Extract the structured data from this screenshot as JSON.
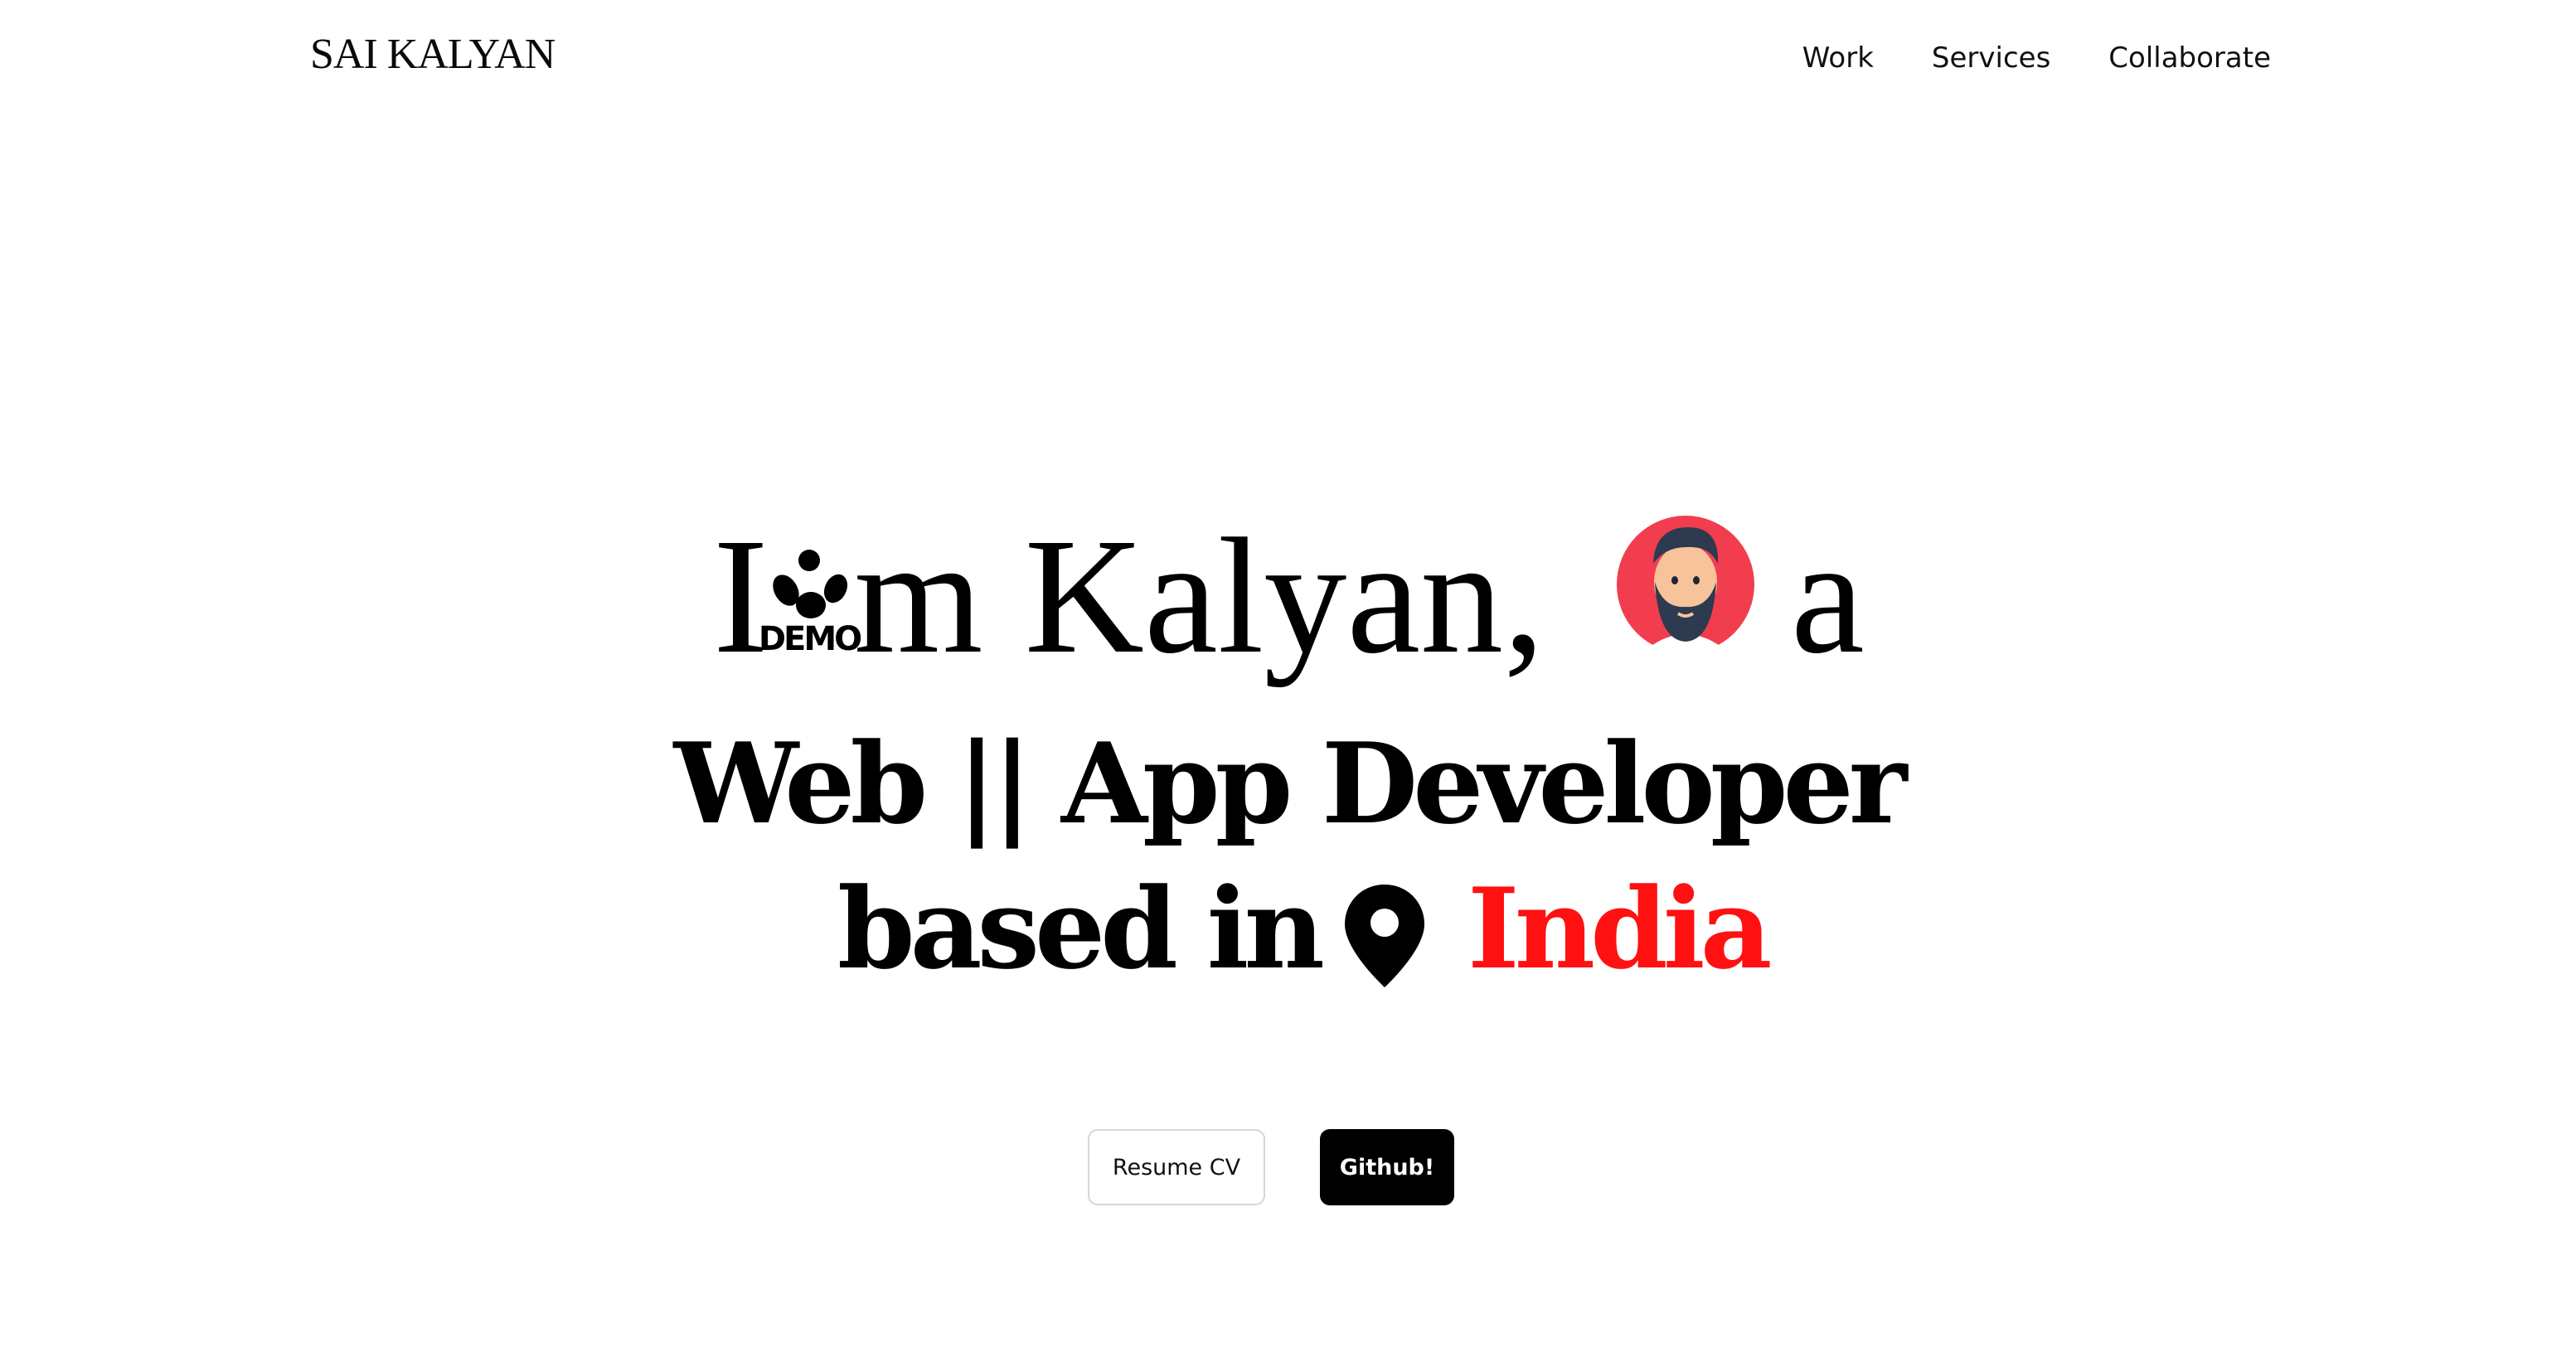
{
  "header": {
    "logo": "SAI KALYAN",
    "nav": [
      {
        "label": "Work"
      },
      {
        "label": "Services"
      },
      {
        "label": "Collaborate"
      }
    ]
  },
  "hero": {
    "line1_start": "I",
    "apostrophe_badge": "DEMO",
    "line1_mid": "m Kalyan,",
    "line1_end": "a",
    "line2": "Web || App Developer",
    "line3_prefix": "based in",
    "country": "India",
    "country_color": "#ff1111",
    "avatar_bg_color": "#f23d4f",
    "icons": {
      "avatar": "bearded-man-avatar-icon",
      "location": "location-pin-icon"
    }
  },
  "actions": {
    "resume_label": "Resume CV",
    "github_label": "Github!"
  }
}
